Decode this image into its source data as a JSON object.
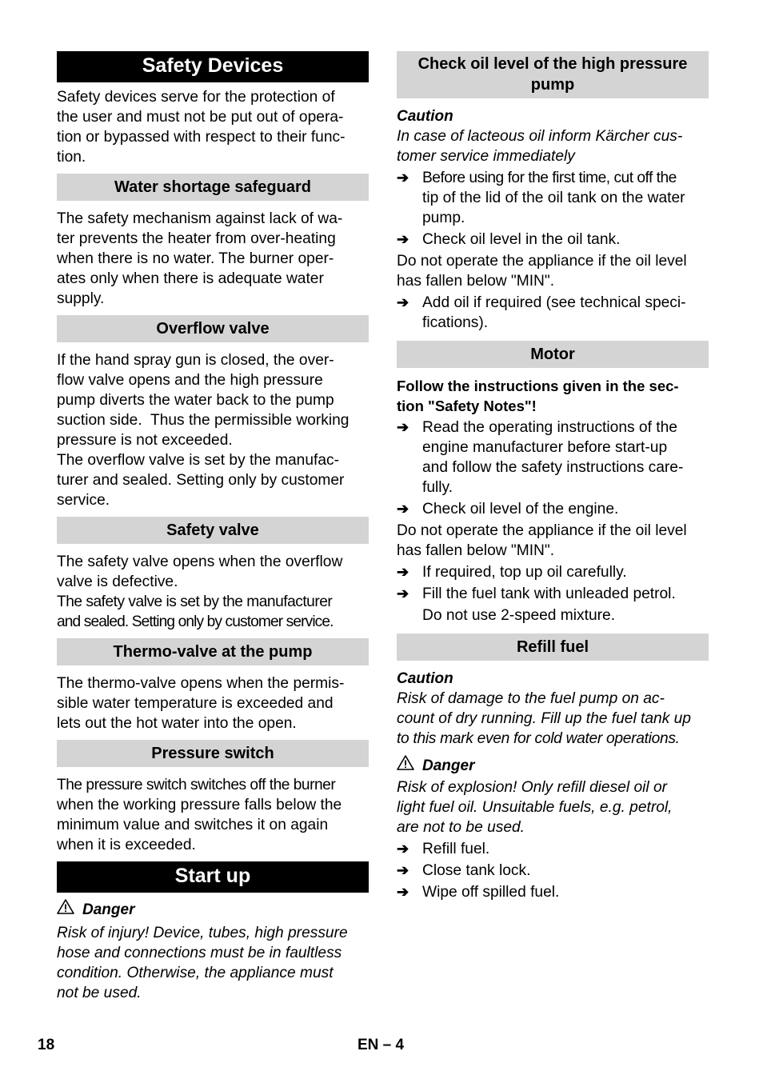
{
  "left": {
    "safety_devices": {
      "title": "Safety Devices",
      "intro": [
        "Safety devices serve for the protection of",
        "the user and must not be put out of opera-",
        "tion or bypassed with respect to their func-",
        "tion."
      ]
    },
    "water_shortage": {
      "title": "Water shortage safeguard",
      "lines": [
        "The safety mechanism against lack of wa-",
        "ter prevents the heater from over-heating",
        "when there is no water. The burner oper-",
        "ates only when there is adequate water",
        "supply."
      ]
    },
    "overflow_valve": {
      "title": "Overflow valve",
      "lines": [
        "If the hand spray gun is closed, the over-",
        "flow valve opens and the high pressure",
        "pump diverts the water back to the pump",
        "suction side.  Thus the permissible working",
        "pressure is not exceeded.",
        "The overflow valve is set by the manufac-",
        "turer and sealed. Setting only by customer",
        "service."
      ]
    },
    "safety_valve": {
      "title": "Safety valve",
      "lines": [
        "The safety valve opens when the overflow",
        "valve is defective.",
        "The safety valve is set by the manufacturer",
        "and sealed. Setting only by customer service."
      ]
    },
    "thermo_valve": {
      "title": "Thermo-valve at the pump",
      "lines": [
        "The thermo-valve opens when the permis-",
        "sible water temperature is exceeded and",
        "lets out the hot water into the open."
      ]
    },
    "pressure_switch": {
      "title": "Pressure switch",
      "lines": [
        "The pressure switch switches off the burner",
        "when the working pressure falls below the",
        "minimum value and switches it on again",
        "when it is exceeded."
      ]
    },
    "start_up": {
      "title": "Start up",
      "danger_label": "Danger",
      "danger_icon": "warning-triangle-icon",
      "danger_lines": [
        "Risk of injury! Device, tubes, high pressure",
        "hose and connections must be in faultless",
        "condition. Otherwise, the appliance must",
        "not be used."
      ]
    }
  },
  "right": {
    "check_oil": {
      "title_lines": [
        "Check oil level of the high pressure",
        "pump"
      ],
      "caution_label": "Caution",
      "caution_lines": [
        "In case of lacteous oil inform Kärcher cus-",
        "tomer service immediately"
      ],
      "step1": [
        "Before using for the first time, cut off the",
        "tip of the lid of the oil tank on the water",
        "pump."
      ],
      "step2": "Check oil level in the oil tank.",
      "note": [
        "Do not operate the appliance if the oil level",
        "has fallen below \"MIN\"."
      ],
      "step3": [
        "Add oil if required (see technical speci-",
        "fications)."
      ]
    },
    "motor": {
      "title": "Motor",
      "bold_lines": [
        "Follow the instructions given in the sec-",
        "tion \"Safety Notes\"!"
      ],
      "step1": [
        "Read the operating instructions of the",
        "engine manufacturer before start-up",
        "and follow the safety instructions care-",
        "fully."
      ],
      "step2": "Check oil level of the engine.",
      "note": [
        "Do not operate the appliance if the oil level",
        "has fallen below \"MIN\"."
      ],
      "step3": "If required, top up oil carefully.",
      "step4": "Fill the fuel tank with unleaded petrol.",
      "step4_cont": "Do not use 2-speed mixture."
    },
    "refill_fuel": {
      "title": "Refill fuel",
      "caution_label": "Caution",
      "caution_lines": [
        "Risk of damage to the fuel pump on ac-",
        "count of dry running. Fill up the fuel tank up",
        "to this mark even for cold water operations."
      ],
      "danger_label": "Danger",
      "danger_lines": [
        "Risk of explosion! Only refill diesel oil or",
        "light fuel oil. Unsuitable fuels, e.g. petrol,",
        "are not to be used."
      ],
      "steps": [
        "Refill fuel.",
        "Close tank lock.",
        "Wipe off spilled fuel."
      ]
    }
  },
  "footer": {
    "page_number": "18",
    "page_ref": "EN – 4"
  },
  "icons": {
    "arrow": "➔",
    "warning": "⚠"
  }
}
